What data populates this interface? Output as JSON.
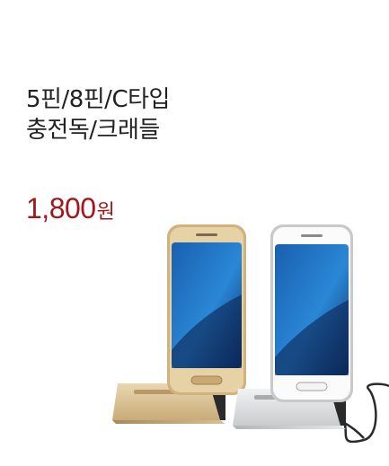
{
  "product": {
    "title_line1": "5핀/8핀/C타입",
    "title_line2": "충전독/크래들",
    "price_value": "1,800",
    "price_unit": "원",
    "image_desc": "gold-and-silver-phone-charging-docks"
  },
  "colors": {
    "price": "#a3171c",
    "title": "#222222",
    "gold": "#d4b98a",
    "silver": "#d9dadc"
  }
}
